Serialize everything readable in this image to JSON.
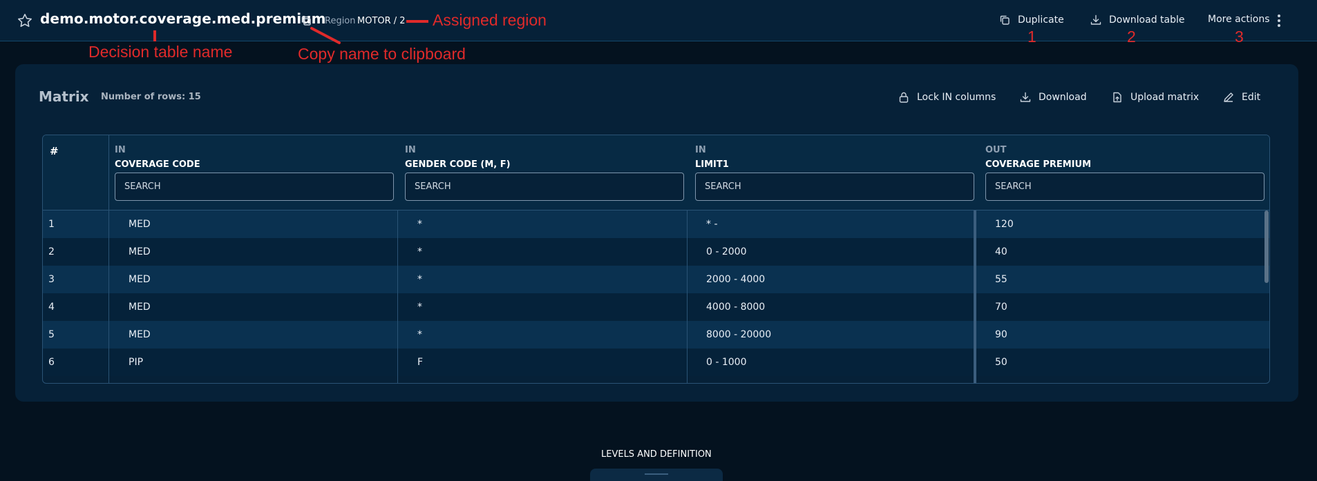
{
  "header": {
    "table_name": "demo.motor.coverage.med.premium",
    "region_label": "Region",
    "region_value": "MOTOR / 2",
    "actions": {
      "duplicate": "Duplicate",
      "download_table": "Download table",
      "more_actions": "More actions"
    }
  },
  "annotations": {
    "assigned_region": "Assigned region",
    "decision_table_name": "Decision table name",
    "copy_name": "Copy name to clipboard",
    "num_1": "1",
    "num_2": "2",
    "num_3": "3",
    "color": "#e02a2a"
  },
  "matrix": {
    "title": "Matrix",
    "row_count": "Number of rows: 15",
    "actions": {
      "lock": "Lock IN columns",
      "download": "Download",
      "upload": "Upload matrix",
      "edit": "Edit"
    },
    "hash_header": "#",
    "columns": [
      {
        "direction": "IN",
        "name": "COVERAGE CODE",
        "placeholder": "SEARCH"
      },
      {
        "direction": "IN",
        "name": "GENDER CODE (M, F)",
        "placeholder": "SEARCH"
      },
      {
        "direction": "IN",
        "name": "LIMIT1",
        "placeholder": "SEARCH"
      },
      {
        "direction": "OUT",
        "name": "COVERAGE PREMIUM",
        "placeholder": "SEARCH"
      }
    ],
    "rows": [
      {
        "num": "1",
        "cells": [
          "MED",
          "*",
          "* -",
          "120"
        ]
      },
      {
        "num": "2",
        "cells": [
          "MED",
          "*",
          "0 - 2000",
          "40"
        ]
      },
      {
        "num": "3",
        "cells": [
          "MED",
          "*",
          "2000 - 4000",
          "55"
        ]
      },
      {
        "num": "4",
        "cells": [
          "MED",
          "*",
          "4000 - 8000",
          "70"
        ]
      },
      {
        "num": "5",
        "cells": [
          "MED",
          "*",
          "8000 - 20000",
          "90"
        ]
      },
      {
        "num": "6",
        "cells": [
          "PIP",
          "F",
          "0 - 1000",
          "50"
        ]
      }
    ]
  },
  "footer": {
    "levels_label": "LEVELS AND DEFINITION"
  },
  "colors": {
    "background": "#04121f",
    "panel": "#062138",
    "row_stripe": "#0a3150",
    "border": "#2a5375"
  }
}
